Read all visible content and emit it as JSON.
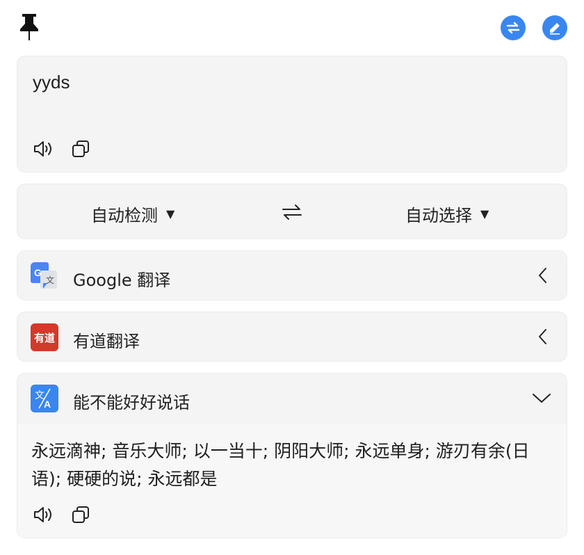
{
  "header": {
    "pin_icon": "pushpin-icon",
    "swap_icon": "swap-arrows-icon",
    "edit_icon": "pencil-icon",
    "accent_color": "#3a86f0"
  },
  "source": {
    "text": "yyds",
    "speak_icon": "speaker-icon",
    "copy_icon": "copy-icon"
  },
  "languages": {
    "from": "自动检测",
    "to": "自动选择",
    "caret_icon": "caret-down-icon",
    "swap_icon": "swap-horizontal-icon"
  },
  "services": [
    {
      "name": "Google 翻译",
      "logo": "google-translate-icon",
      "state_icon": "chevron-left-icon",
      "expanded": false
    },
    {
      "name": "有道翻译",
      "logo": "youdao-icon",
      "logo_text": "有道",
      "state_icon": "chevron-left-icon",
      "expanded": false
    },
    {
      "name": "能不能好好说话",
      "logo": "translate-icon",
      "state_icon": "chevron-down-icon",
      "expanded": true
    }
  ],
  "result": {
    "text": "永远滴神; 音乐大师; 以一当十; 阴阳大师; 永远单身; 游刃有余(日语); 硬硬的说; 永远都是",
    "speak_icon": "speaker-icon",
    "copy_icon": "copy-icon"
  }
}
